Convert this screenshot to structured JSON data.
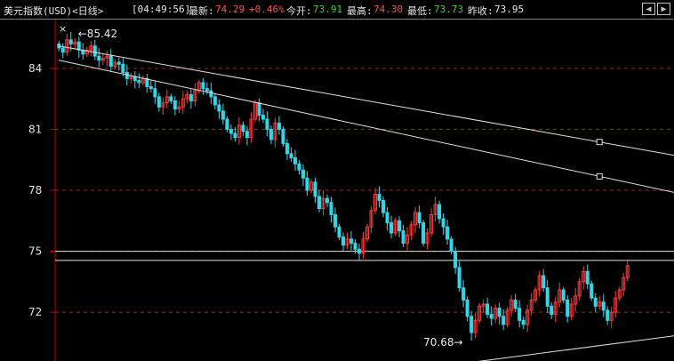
{
  "header": {
    "title": "美元指数(USD)<日线>",
    "time": "[04:49:56]",
    "latest_label": "最新:",
    "latest_value": "74.29",
    "change": "+0.46%",
    "open_label": "今开:",
    "open_value": "73.91",
    "high_label": "最高:",
    "high_value": "74.30",
    "low_label": "最低:",
    "low_value": "73.73",
    "prev_close_label": "昨收:",
    "prev_close_value": "73.95"
  },
  "toolbar": {
    "back_icon": "arrow-left-icon",
    "forward_icon": "arrow-right-icon"
  },
  "colors": {
    "up": "#ff3a3a",
    "down": "#33d6e6",
    "grid": "#b02020",
    "axis": "#c00000",
    "line": "#e0e0e0"
  },
  "chart_data": {
    "type": "candlestick",
    "ylim": [
      69.6,
      86.4
    ],
    "y_ticks": [
      "84",
      "81",
      "78",
      "75",
      "72"
    ],
    "y_tick_values": [
      84,
      81,
      78,
      75,
      72
    ],
    "annotations": {
      "high": "85.42",
      "low": "70.68"
    },
    "horizontal_levels": [
      75.0,
      74.55
    ],
    "trendlines": [
      {
        "from": [
          0,
          85.1
        ],
        "to": [
          300,
          74.6
        ]
      },
      {
        "from": [
          0,
          84.4
        ],
        "to": [
          300,
          71.7
        ]
      },
      {
        "from": [
          90,
          69.2
        ],
        "to": [
          300,
          74.6
        ]
      }
    ],
    "closes": [
      85.0,
      84.8,
      85.4,
      85.2,
      85.3,
      84.9,
      84.7,
      84.9,
      85.1,
      84.6,
      84.4,
      84.5,
      84.6,
      84.1,
      84.3,
      84.2,
      83.8,
      83.5,
      83.6,
      83.4,
      83.3,
      83.5,
      83.1,
      83.0,
      82.6,
      82.1,
      82.3,
      82.6,
      82.4,
      82.0,
      82.1,
      82.5,
      82.7,
      82.4,
      82.9,
      83.3,
      83.0,
      82.9,
      82.6,
      82.2,
      81.9,
      81.5,
      81.0,
      80.8,
      80.6,
      81.2,
      80.9,
      80.6,
      81.5,
      82.3,
      81.7,
      81.5,
      81.0,
      80.5,
      81.3,
      81.0,
      80.3,
      79.8,
      79.6,
      79.3,
      79.0,
      78.6,
      78.0,
      78.4,
      77.7,
      77.1,
      77.6,
      77.4,
      76.8,
      76.2,
      75.7,
      75.3,
      75.6,
      75.4,
      75.1,
      74.9,
      75.6,
      76.2,
      77.0,
      77.8,
      77.5,
      76.9,
      76.4,
      75.9,
      76.5,
      76.0,
      75.4,
      75.8,
      76.3,
      76.9,
      76.4,
      75.4,
      75.9,
      76.8,
      77.3,
      76.6,
      76.2,
      75.6,
      75.0,
      74.2,
      73.2,
      72.6,
      71.8,
      71.0,
      71.6,
      72.3,
      72.4,
      71.9,
      71.7,
      72.2,
      71.8,
      71.4,
      72.1,
      72.6,
      72.2,
      71.6,
      71.4,
      72.1,
      72.6,
      73.1,
      73.8,
      73.2,
      72.3,
      71.9,
      72.5,
      73.1,
      72.6,
      71.8,
      72.4,
      72.8,
      73.5,
      74.0,
      73.4,
      72.7,
      72.3,
      72.5,
      72.1,
      71.6,
      72.0,
      72.7,
      73.1,
      73.7,
      74.29
    ]
  }
}
